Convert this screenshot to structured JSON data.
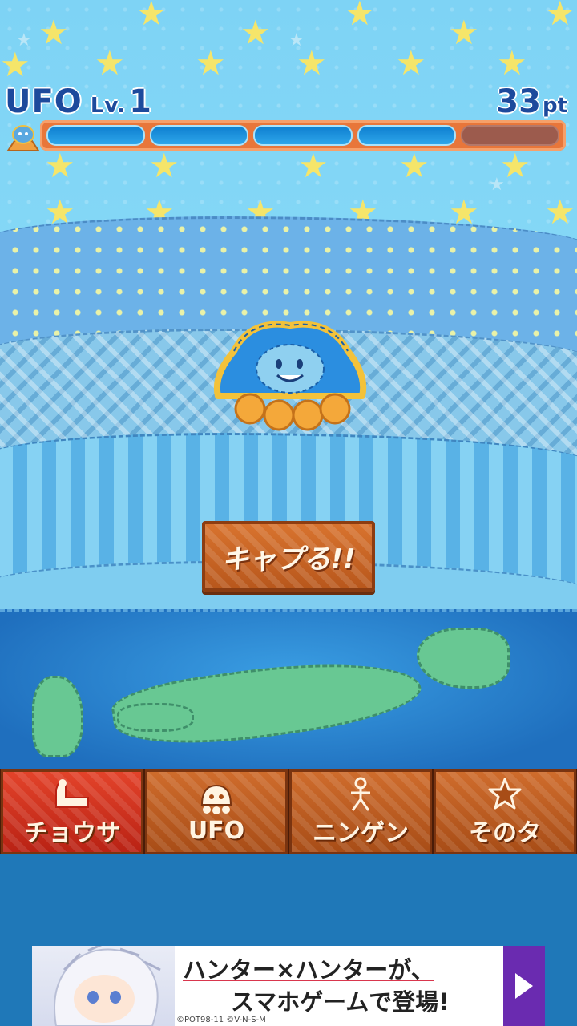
{
  "hud": {
    "title": "UFO",
    "level_label": "Lv.",
    "level_value": "1",
    "points_value": "33",
    "points_unit": "pt",
    "progress_filled_segments": 4,
    "progress_total_segments": 5
  },
  "action": {
    "capture_label": "キャプる!!"
  },
  "tabs": [
    {
      "label": "チョウサ",
      "icon": "sofa-icon",
      "active": true
    },
    {
      "label": "UFO",
      "icon": "ufo-icon",
      "active": false
    },
    {
      "label": "ニンゲン",
      "icon": "person-icon",
      "active": false
    },
    {
      "label": "そのタ",
      "icon": "star-icon",
      "active": false
    }
  ],
  "ad": {
    "line1": "ハンター×ハンターが、",
    "line2": "スマホゲームで登場!",
    "copyright": "©POT98-11 ©V-N-S-M"
  },
  "colors": {
    "accent_text": "#1d4a9c",
    "progress_fill": "#0e7fd0",
    "tab_active": "#e3432a",
    "tab_inactive": "#cf6c2c"
  }
}
